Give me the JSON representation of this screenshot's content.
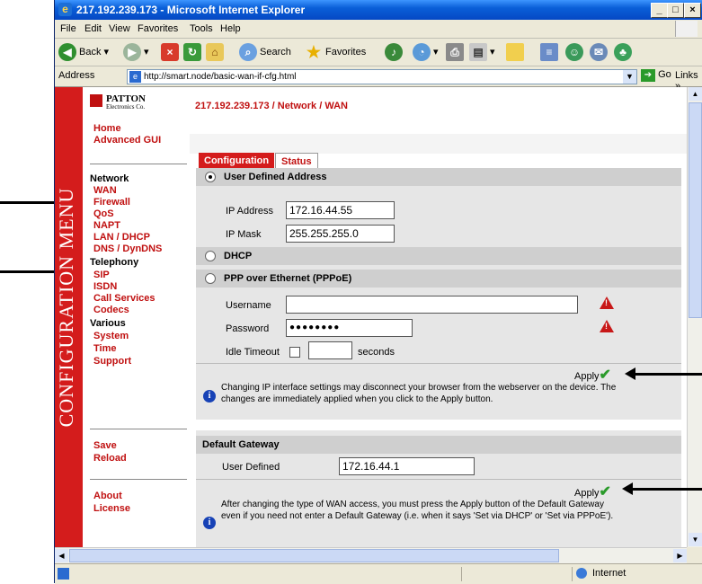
{
  "window": {
    "title": "217.192.239.173 - Microsoft Internet Explorer"
  },
  "menu": [
    "File",
    "Edit",
    "View",
    "Favorites",
    "Tools",
    "Help"
  ],
  "toolbar": {
    "back": "Back",
    "search": "Search",
    "favorites": "Favorites"
  },
  "address": {
    "label": "Address",
    "url": "http://smart.node/basic-wan-if-cfg.html",
    "go": "Go",
    "links": "Links"
  },
  "sidebar": {
    "vertical_label": "CONFIGURATION MENU",
    "logo_line1": "PATTON",
    "logo_line2": "Electronics Co.",
    "top_links": [
      "Home",
      "Advanced GUI"
    ],
    "network": {
      "heading": "Network",
      "items": [
        "WAN",
        "Firewall",
        "QoS",
        "NAPT",
        "LAN / DHCP",
        "DNS / DynDNS"
      ]
    },
    "telephony": {
      "heading": "Telephony",
      "items": [
        "SIP",
        "ISDN",
        "Call Services",
        "Codecs"
      ]
    },
    "various": {
      "heading": "Various",
      "items": [
        "System",
        "Time",
        "Support"
      ]
    },
    "actions": [
      "Save",
      "Reload"
    ],
    "info": [
      "About",
      "License"
    ]
  },
  "main": {
    "breadcrumb": "217.192.239.173 / Network / WAN",
    "tabs": [
      "Configuration",
      "Status"
    ],
    "user_defined": {
      "label": "User Defined Address",
      "ip_label": "IP Address",
      "ip_value": "172.16.44.55",
      "mask_label": "IP Mask",
      "mask_value": "255.255.255.0"
    },
    "dhcp_label": "DHCP",
    "pppoe": {
      "label": "PPP over Ethernet (PPPoE)",
      "username_label": "Username",
      "username_value": "",
      "password_label": "Password",
      "password_value": "●●●●●●●●",
      "idle_label": "Idle Timeout",
      "idle_value": "",
      "idle_unit": "seconds"
    },
    "apply_label": "Apply",
    "note1": "Changing IP interface settings may disconnect your browser from the webserver on the device. The changes are immediately applied when you click to the Apply button.",
    "gateway": {
      "header": "Default Gateway",
      "label": "User Defined",
      "value": "172.16.44.1"
    },
    "note2": "After changing the type of WAN access, you must press the Apply button of the Default Gateway even if you need not enter a Default Gateway (i.e. when it says 'Set via DHCP' or 'Set via PPPoE')."
  },
  "status": {
    "zone": "Internet"
  },
  "colors": {
    "accent": "#d41c1c",
    "panel": "#e6e6e6",
    "header": "#cfcfcf"
  }
}
